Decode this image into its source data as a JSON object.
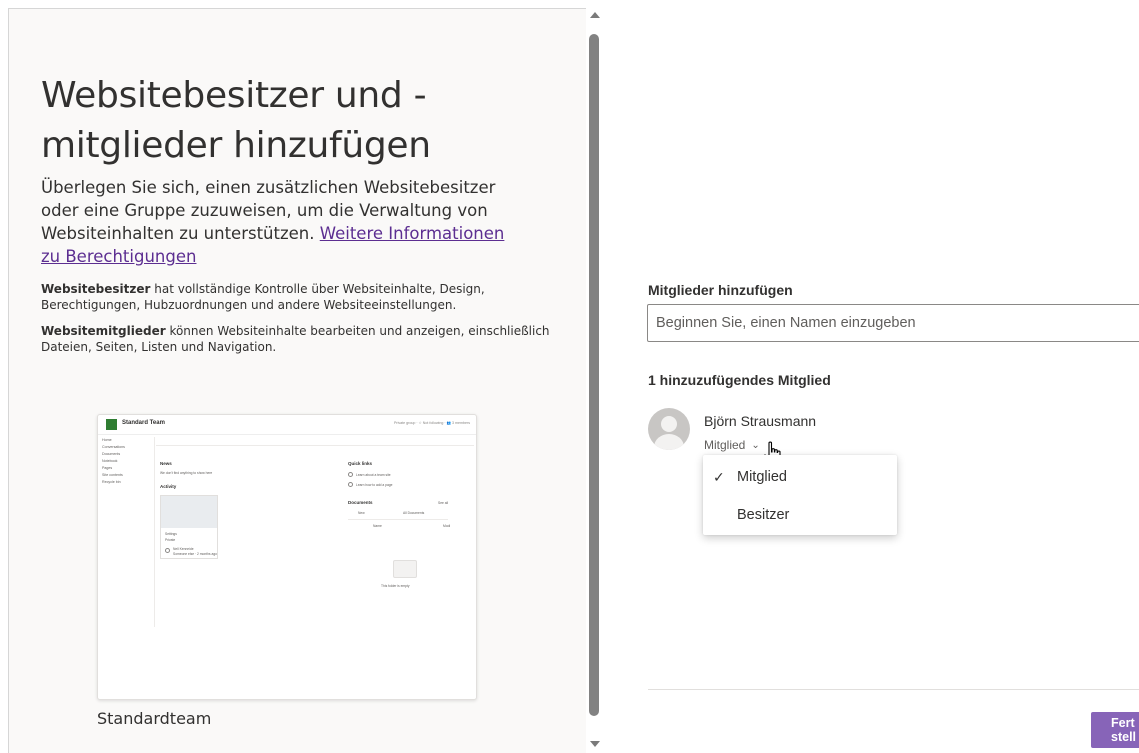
{
  "left": {
    "title": "Websitebesitzer und -mitglieder hinzufügen",
    "intro_text": "Überlegen Sie sich, einen zusätzlichen Websitebesitzer oder eine Gruppe zuzuweisen, um die Verwaltung von Websiteinhalten zu unterstützen. ",
    "intro_link": "Weitere Informationen zu Berechtigungen",
    "owners_bold": "Websitebesitzer",
    "owners_text": " hat vollständige Kontrolle über Websiteinhalte, Design, Berechtigungen, Hubzuordnungen und andere Websiteeinstellungen.",
    "members_bold": "Websitemitglieder",
    "members_text": " können Websiteinhalte bearbeiten und anzeigen, einschließlich Dateien, Seiten, Listen und Navigation.",
    "template_name": "Standardteam",
    "preview": {
      "site_name": "Standard Team",
      "header_right": "Private group · ☆ Not following · 👥 3 members",
      "nav": [
        "Home",
        "Conversations",
        "Documents",
        "Notebook",
        "Pages",
        "Site contents",
        "Recycle bin"
      ],
      "news_title": "News",
      "news_text": "We don't find anything to show here",
      "activity_title": "Activity",
      "card_text1": "Settings",
      "card_text2": "Private",
      "card_user": "Nell Kenneide",
      "card_user_sub": "Someone else · 2 months ago",
      "quick_links_title": "Quick links",
      "quick_link1": "Learn about a team site",
      "quick_link2": "Learn how to add a page",
      "documents_title": "Documents",
      "see_all": "See all",
      "new_label": "New",
      "all_documents": "All Documents",
      "name_col": "Name",
      "modified_col": "Modi",
      "empty_text": "This folder is empty"
    }
  },
  "right": {
    "add_members_label": "Mitglieder hinzufügen",
    "input_placeholder": "Beginnen Sie, einen Namen einzugeben",
    "members_count": "1 hinzuzufügendes Mitglied",
    "member_name": "Björn Strausmann",
    "member_role": "Mitglied",
    "menu_items": [
      "Mitglied",
      "Besitzer"
    ],
    "finish_button": "Fertig stellen",
    "finish_line1": "Fert",
    "finish_line2": "stell"
  },
  "colors": {
    "accent": "#8764b8",
    "link": "#5c2e91",
    "panel_bg": "#faf9f8"
  },
  "icons": [
    "chevron-down-icon",
    "checkmark-icon",
    "hand-cursor-icon",
    "person-avatar-icon",
    "scroll-up-arrow-icon",
    "scroll-down-arrow-icon"
  ]
}
